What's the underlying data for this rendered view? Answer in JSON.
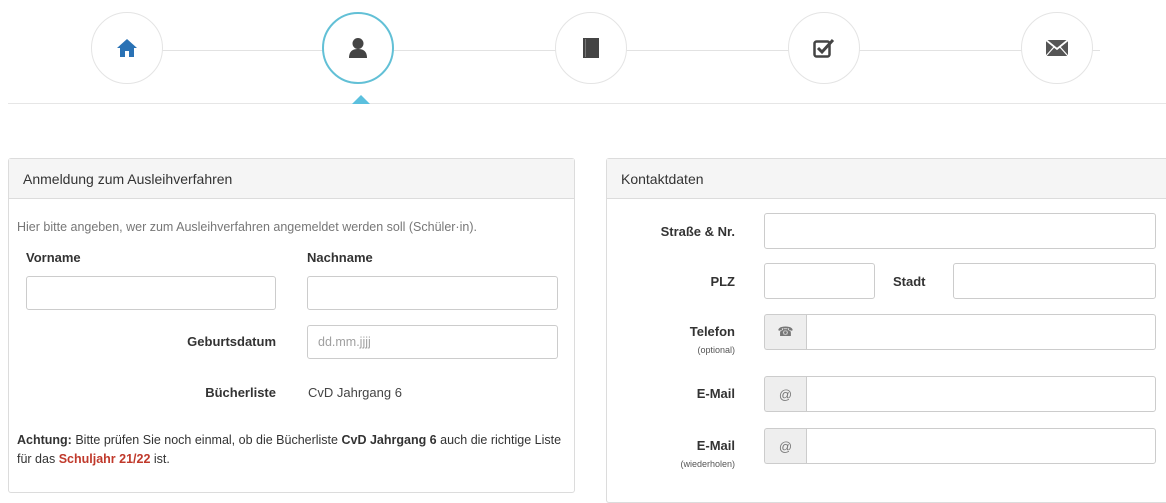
{
  "wizard": {
    "steps": [
      {
        "icon": "home-icon"
      },
      {
        "icon": "user-icon"
      },
      {
        "icon": "book-icon"
      },
      {
        "icon": "check-icon"
      },
      {
        "icon": "envelope-icon"
      }
    ],
    "active_index": 1,
    "colors": {
      "active_border": "#62c0d6",
      "home_icon": "#2a72b5",
      "icon": "#444444"
    }
  },
  "registration": {
    "title": "Anmeldung zum Ausleihverfahren",
    "hint": "Hier bitte angeben, wer zum Ausleihverfahren angemeldet werden soll (Schüler·in).",
    "firstname_label": "Vorname",
    "firstname_value": "",
    "lastname_label": "Nachname",
    "lastname_value": "",
    "birthdate_label": "Geburtsdatum",
    "birthdate_placeholder": "dd.mm.jjjj",
    "booklist_label": "Bücherliste",
    "booklist_value": "CvD Jahrgang 6",
    "note": {
      "prefix": "Achtung:",
      "text1": " Bitte prüfen Sie noch einmal, ob die Bücherliste ",
      "list": "CvD Jahrgang 6",
      "text2": " auch die richtige Liste für das ",
      "year": "Schuljahr 21/22",
      "text3": " ist."
    }
  },
  "contact": {
    "title": "Kontaktdaten",
    "street_label": "Straße & Nr.",
    "street_value": "",
    "zip_label": "PLZ",
    "zip_value": "",
    "city_label": "Stadt",
    "city_value": "",
    "phone_label": "Telefon",
    "phone_sub": "(optional)",
    "phone_icon": "telephone-icon",
    "phone_icon_glyph": "☎",
    "phone_value": "",
    "email_label": "E-Mail",
    "email_addon": "@",
    "email_value": "",
    "email_repeat_label": "E-Mail",
    "email_repeat_sub": "(wiederholen)",
    "email_repeat_addon": "@",
    "email_repeat_value": ""
  }
}
